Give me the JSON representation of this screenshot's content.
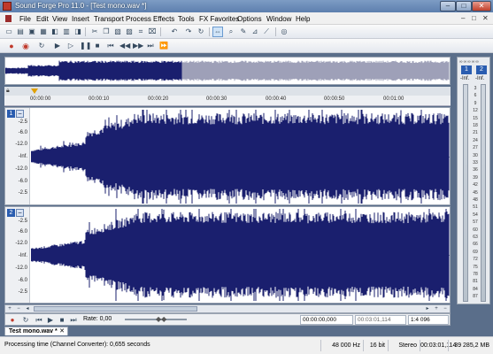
{
  "window": {
    "title": "Sound Forge Pro 11.0 - [Test mono.wav *]",
    "min": "–",
    "max": "□",
    "close": "✕"
  },
  "menu": {
    "items": [
      "File",
      "Edit",
      "View",
      "Insert",
      "Transport",
      "Process",
      "Effects",
      "Tools",
      "FX Favorites",
      "Options",
      "Window",
      "Help"
    ],
    "doc_controls": [
      "–",
      "□",
      "✕"
    ]
  },
  "toolbar1": [
    "new-icon",
    "open-icon",
    "save-icon",
    "save-all-icon",
    "properties-icon",
    "cut-icon",
    "copy-icon",
    "paste-icon",
    "mix-icon",
    "crop-icon",
    "undo-icon",
    "redo-icon",
    "repeat-icon",
    "edit-tool-icon",
    "magnify-tool-icon",
    "pencil-tool-icon",
    "event-tool-icon",
    "envelope-tool-icon",
    "cd-tool-icon"
  ],
  "toolbar2": [
    "record-icon",
    "record-arm-icon",
    "loop-icon",
    "play-all-icon",
    "play-icon",
    "pause-icon",
    "stop-icon",
    "go-start-icon",
    "rewind-icon",
    "forward-icon",
    "go-end-icon"
  ],
  "ruler": {
    "ticks": [
      "00:00:00",
      "00:00:10",
      "00:00:20",
      "00:00:30",
      "00:00:40",
      "00:00:50",
      "00:01:00"
    ]
  },
  "channels": [
    {
      "label": "1",
      "db_scale": [
        "-2.5",
        "-6.0",
        "-12.0",
        "-Inf.",
        "-12.0",
        "-6.0",
        "-2.5"
      ]
    },
    {
      "label": "2",
      "db_scale": [
        "-2.5",
        "-6.0",
        "-12.0",
        "-Inf.",
        "-12.0",
        "-6.0",
        "-2.5"
      ]
    }
  ],
  "meter": {
    "header": "∞∞∞∞∞",
    "ch1": "1",
    "ch2": "2",
    "peak1": "-Inf.",
    "peak2": "-Inf.",
    "scale": [
      "3",
      "6",
      "9",
      "12",
      "15",
      "18",
      "21",
      "24",
      "27",
      "30",
      "33",
      "36",
      "39",
      "42",
      "45",
      "48",
      "51",
      "54",
      "57",
      "60",
      "63",
      "66",
      "69",
      "72",
      "75",
      "78",
      "81",
      "84",
      "87"
    ]
  },
  "transport": {
    "rate": "Rate: 0,00",
    "cursor_pos": "00:00:00,000",
    "length": "00:03:01,114",
    "zoom": "1:4 096"
  },
  "doc_tab": {
    "label": "Test mono.wav *",
    "close": "✕"
  },
  "status": {
    "message": "Processing time (Channel Converter): 0,655 seconds",
    "sample_rate": "48 000 Hz",
    "bit_depth": "16 bit",
    "channels": "Stereo",
    "length": "00:03:01,114",
    "free_space": "39 285,2 MB"
  },
  "colors": {
    "waveform": "#1a1f6e",
    "overview_unselected": "#9ea0b8",
    "accent": "#2a5db0"
  }
}
